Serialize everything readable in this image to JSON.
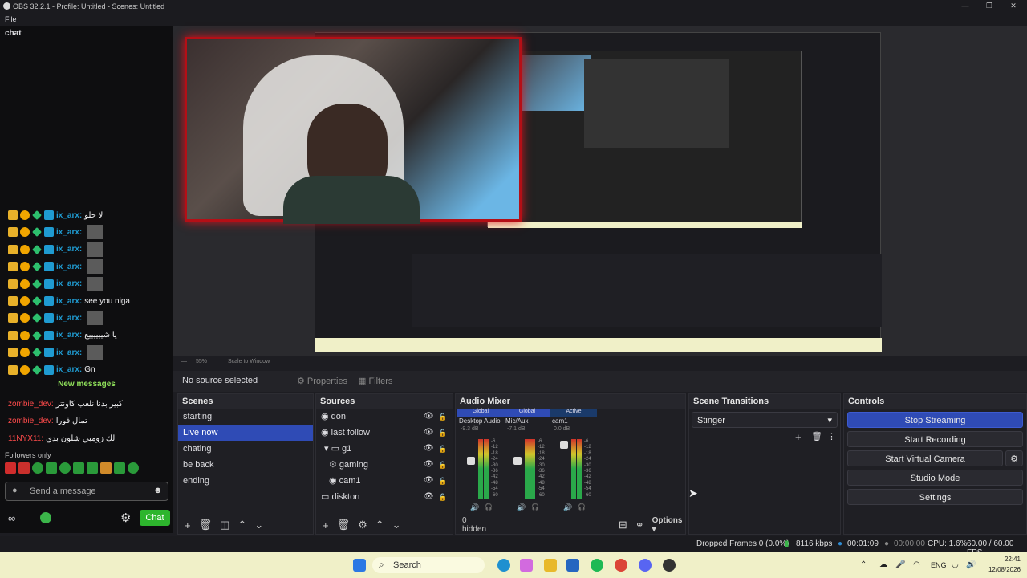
{
  "window": {
    "title": "OBS 32.2.1 - Profile: Untitled - Scenes: Untitled"
  },
  "menu": {
    "file": "File"
  },
  "chat_panel": {
    "tab": "chat",
    "lines": [
      {
        "user": "ix_arx:",
        "text": "لا حلو"
      },
      {
        "user": "ix_arx:",
        "text": ""
      },
      {
        "user": "ix_arx:",
        "text": ""
      },
      {
        "user": "ix_arx:",
        "text": ""
      },
      {
        "user": "ix_arx:",
        "text": ""
      },
      {
        "user": "ix_arx:",
        "text": "see you niga"
      },
      {
        "user": "ix_arx:",
        "text": ""
      },
      {
        "user": "ix_arx:",
        "text": "يا شييييييع"
      },
      {
        "user": "ix_arx:",
        "text": ""
      },
      {
        "user": "ix_arx:",
        "text": "Gn"
      }
    ],
    "new_messages": "New messages",
    "new_lines": [
      {
        "user": "zombie_dev:",
        "text": "كبير بدنا نلعب كاونتر"
      },
      {
        "user": "zombie_dev:",
        "text": "تمال فورا"
      },
      {
        "user": "11NYX11:",
        "text": "لك زومبي شلون بدي"
      }
    ],
    "followers_only": "Followers only",
    "send_placeholder": "Send a message",
    "chat_button": "Chat"
  },
  "toolbar": {
    "no_source": "No source selected",
    "properties": "Properties",
    "filters": "Filters",
    "zoom": "55%",
    "scale": "Scale to Window"
  },
  "scenes": {
    "title": "Scenes",
    "items": [
      "starting",
      "Live now",
      "chating",
      "be back",
      "ending"
    ],
    "selected": 1
  },
  "sources": {
    "title": "Sources",
    "items": [
      {
        "name": "don",
        "icon": "camera"
      },
      {
        "name": "last follow",
        "icon": "camera"
      },
      {
        "name": "g1",
        "icon": "folder"
      },
      {
        "name": "gaming",
        "icon": "gear"
      },
      {
        "name": "cam1",
        "icon": "camera"
      },
      {
        "name": "diskton",
        "icon": "monitor"
      }
    ]
  },
  "audio_mixer": {
    "title": "Audio Mixer",
    "channels": [
      {
        "tag": "Global",
        "name": "Desktop Audio",
        "db": "-9.3 dB"
      },
      {
        "tag": "Global",
        "name": "Mic/Aux",
        "db": "-7.1 dB"
      },
      {
        "tag": "Active",
        "name": "cam1",
        "db": "0.0 dB"
      }
    ],
    "ticks": [
      "-6",
      "-12",
      "-18",
      "-24",
      "-30",
      "-36",
      "-42",
      "-48",
      "-54",
      "-60"
    ],
    "hidden": "0 hidden",
    "options": "Options"
  },
  "transitions": {
    "title": "Scene Transitions",
    "selected": "Stinger"
  },
  "controls": {
    "title": "Controls",
    "buttons": [
      "Stop Streaming",
      "Start Recording",
      "Start Virtual Camera",
      "Studio Mode",
      "Settings"
    ]
  },
  "status": {
    "dropped": "Dropped Frames 0 (0.0%)",
    "kbps": "8116 kbps",
    "stream_time": "00:01:09",
    "rec_time": "00:00:00",
    "cpu": "CPU: 1.6%",
    "fps": "60.00 / 60.00 FPS"
  },
  "taskbar": {
    "search": "Search",
    "lang": "ENG",
    "time": "22:41",
    "date": "12/08/2026"
  }
}
